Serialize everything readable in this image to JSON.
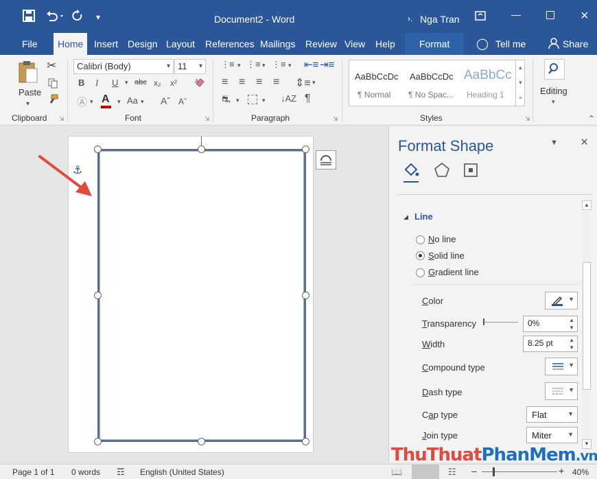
{
  "title": "Document2 - Word",
  "user": "Nga Tran",
  "tabs": [
    "File",
    "Home",
    "Insert",
    "Design",
    "Layout",
    "References",
    "Mailings",
    "Review",
    "View",
    "Help",
    "Format"
  ],
  "tell_me": "Tell me",
  "share": "Share",
  "ribbon": {
    "paste": "Paste",
    "font_name": "Calibri (Body)",
    "font_size": "11",
    "styles": [
      {
        "preview": "AaBbCcDc",
        "name": "¶ Normal"
      },
      {
        "preview": "AaBbCcDc",
        "name": "¶ No Spac..."
      },
      {
        "preview": "AaBbCc",
        "name": "Heading 1"
      }
    ],
    "editing": "Editing",
    "groups": {
      "clipboard": "Clipboard",
      "font": "Font",
      "paragraph": "Paragraph",
      "styles": "Styles"
    }
  },
  "pane": {
    "title": "Format Shape",
    "section": "Line",
    "radio": [
      {
        "pre": "",
        "key": "N",
        "post": "o line",
        "selected": false
      },
      {
        "pre": "",
        "key": "S",
        "post": "olid line",
        "selected": true
      },
      {
        "pre": "",
        "key": "G",
        "post": "radient line",
        "selected": false
      }
    ],
    "color_label": {
      "pre": "",
      "key": "C",
      "post": "olor"
    },
    "transparency_label": {
      "pre": "",
      "key": "T",
      "post": "ransparency"
    },
    "transparency_value": "0%",
    "width_label": {
      "pre": "",
      "key": "W",
      "post": "idth"
    },
    "width_value": "8.25 pt",
    "compound_label": {
      "pre": "",
      "key": "C",
      "post": "ompound type"
    },
    "dash_label": {
      "pre": "",
      "key": "D",
      "post": "ash type"
    },
    "cap_label": {
      "pre": "C",
      "key": "a",
      "post": "p type"
    },
    "cap_value": "Flat",
    "join_label": {
      "pre": "",
      "key": "J",
      "post": "oin type"
    },
    "join_value": "Miter"
  },
  "status": {
    "page": "Page 1 of 1",
    "words": "0 words",
    "language": "English (United States)",
    "zoom": "40%"
  },
  "watermark": {
    "a": "Thu",
    "b": "Thuat",
    "c": "Phan",
    "d": "Mem",
    ".vn": ".vn"
  },
  "colors": {
    "brand": "#2b579a",
    "accent": "#c0504d"
  }
}
